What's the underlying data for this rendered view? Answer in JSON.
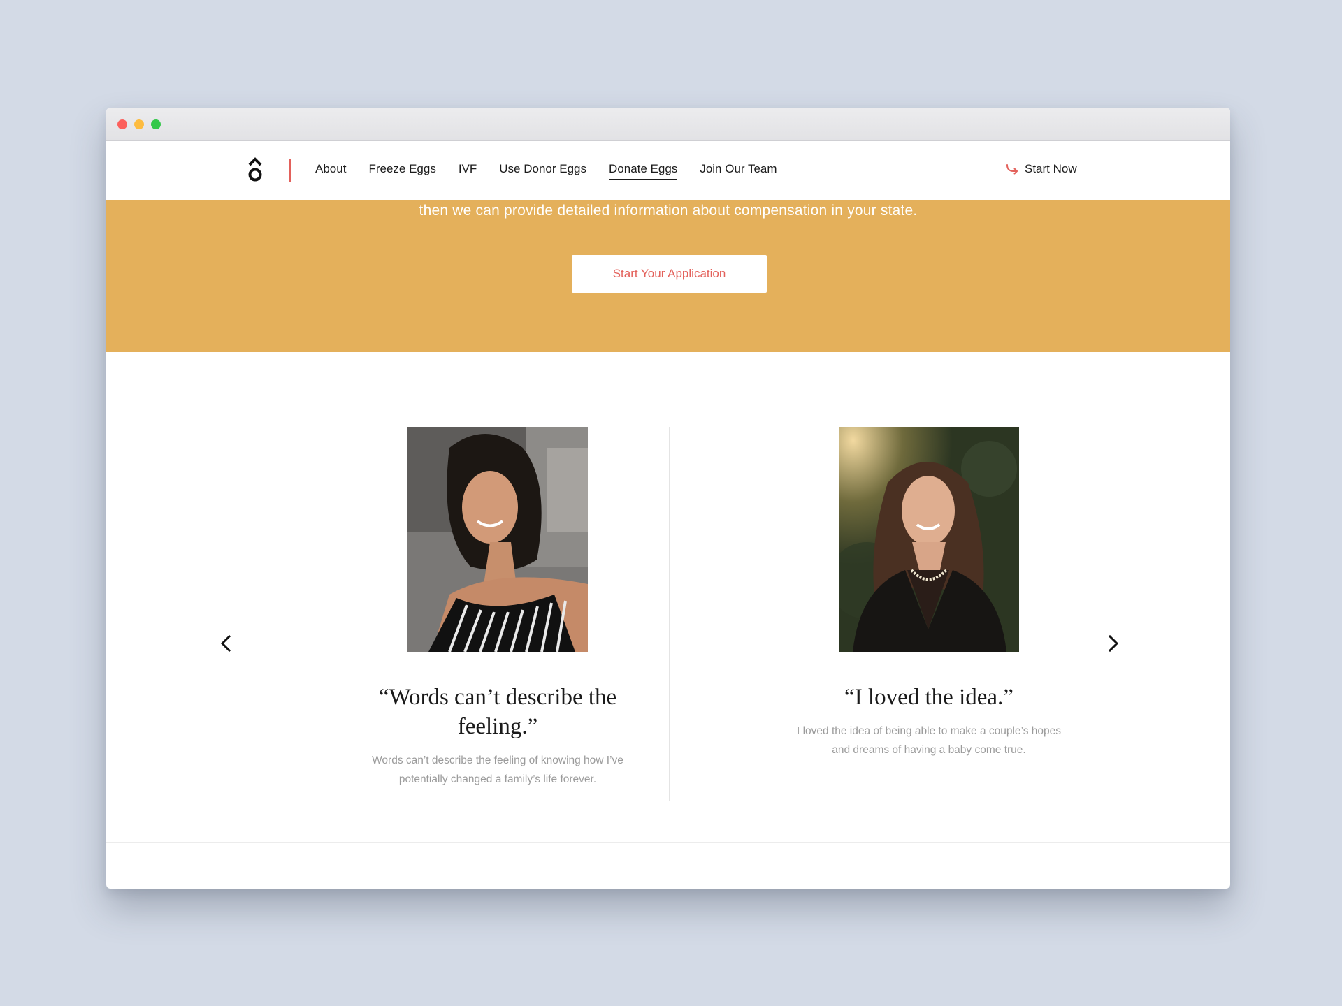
{
  "nav": {
    "links": [
      "About",
      "Freeze Eggs",
      "IVF",
      "Use Donor Eggs",
      "Donate Eggs",
      "Join Our Team"
    ],
    "active": "Donate Eggs",
    "cta": "Start Now"
  },
  "banner": {
    "text": "then we can provide detailed information about compensation in your state.",
    "button": "Start Your Application"
  },
  "testimonials": [
    {
      "quote": "“Words can’t describe the feeling.”",
      "body": "Words can’t describe the feeling of knowing how I’ve potentially changed a family’s life forever."
    },
    {
      "quote": "“I loved the idea.”",
      "body": "I loved the idea of being able to make a couple’s hopes and dreams of having a baby come true."
    }
  ],
  "colors": {
    "accent": "#e3615b",
    "banner": "#e4b05b",
    "background": "#d3dae6"
  }
}
